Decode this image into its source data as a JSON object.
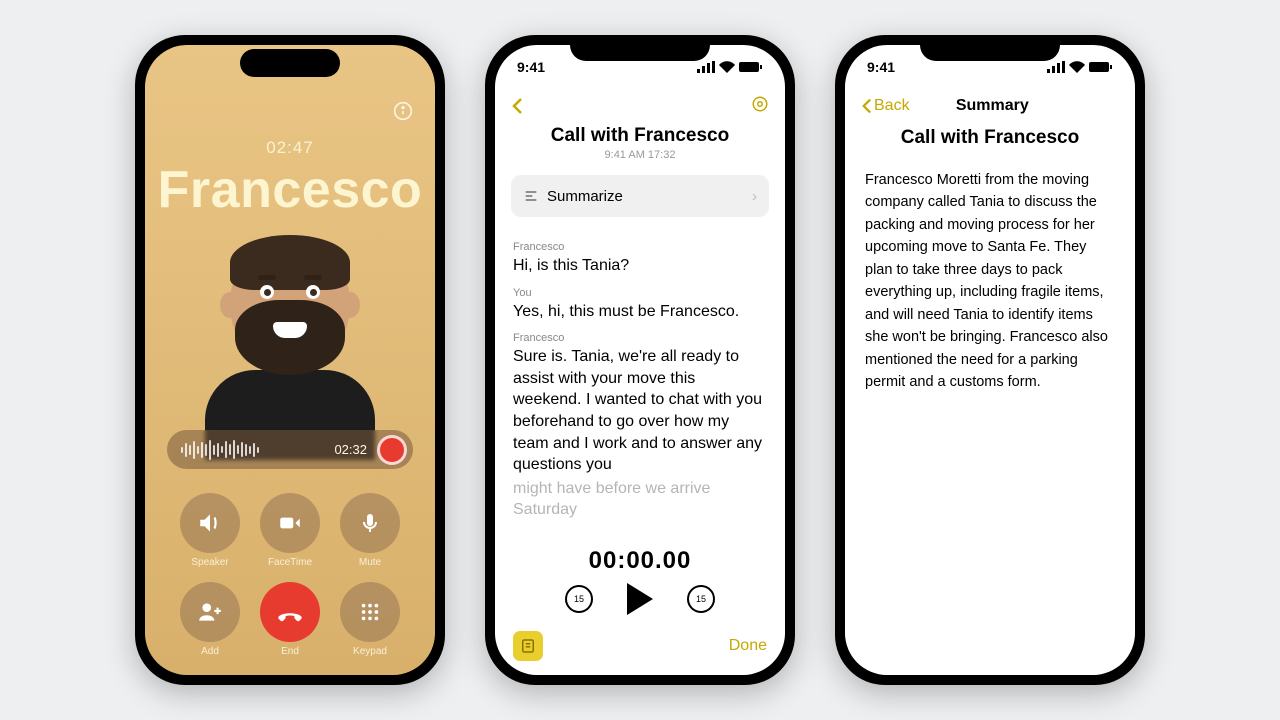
{
  "status_time": "9:41",
  "phone1": {
    "duration": "02:47",
    "caller": "Francesco",
    "rec_time": "02:32",
    "buttons": {
      "speaker": "Speaker",
      "facetime": "FaceTime",
      "mute": "Mute",
      "add": "Add",
      "end": "End",
      "keypad": "Keypad"
    }
  },
  "phone2": {
    "back": "",
    "title": "Call with Francesco",
    "subtitle": "9:41 AM   17:32",
    "summarize": "Summarize",
    "transcript": [
      {
        "speaker": "Francesco",
        "text": "Hi, is this Tania?"
      },
      {
        "speaker": "You",
        "text": "Yes, hi, this must be Francesco."
      },
      {
        "speaker": "Francesco",
        "text": "Sure is. Tania, we're all ready to assist with your move this weekend. I wanted to chat with you beforehand to go over how my team and I work and to answer any questions you"
      },
      {
        "speaker": "",
        "text": "might have before we arrive Saturday"
      }
    ],
    "player_time": "00:00.00",
    "skip_back": "15",
    "skip_fwd": "15",
    "done": "Done"
  },
  "phone3": {
    "back": "Back",
    "nav_title": "Summary",
    "title": "Call with Francesco",
    "body": "Francesco Moretti from the moving company called Tania to discuss the packing and moving process for her upcoming move to Santa Fe. They plan to take three days to pack everything up, including fragile items, and will need Tania to identify items she won't be bringing. Francesco also mentioned the need for a parking permit and a customs form."
  }
}
